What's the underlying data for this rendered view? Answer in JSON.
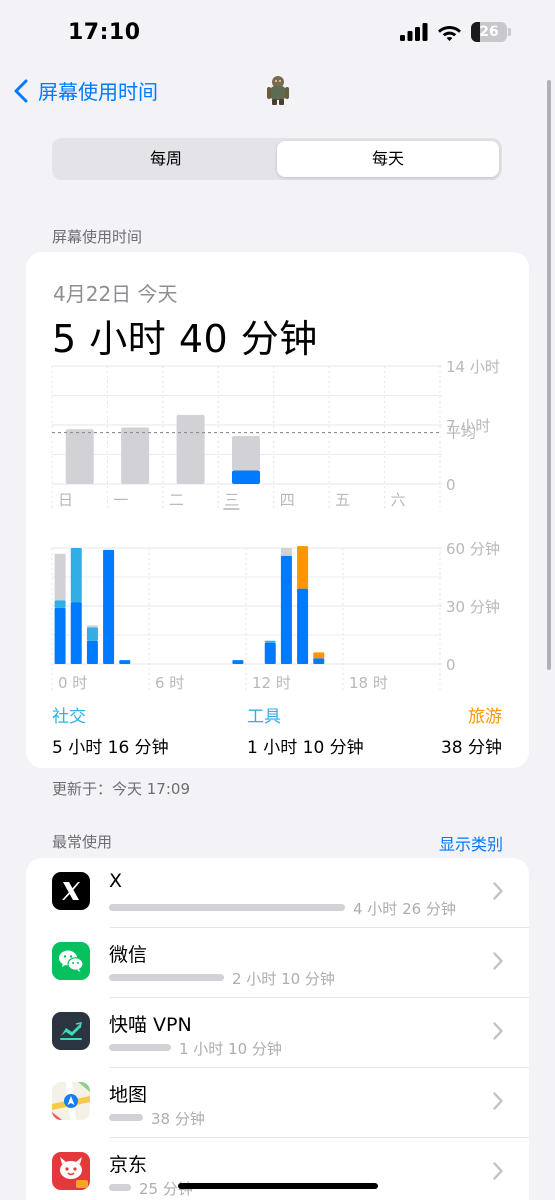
{
  "status_bar": {
    "time": "17:10",
    "battery_level": "26",
    "icons": [
      "cellular-signal-icon",
      "wifi-icon",
      "battery-icon"
    ]
  },
  "nav": {
    "back_label": "屏幕使用时间",
    "back_icon": "chevron-left-icon"
  },
  "segmented": {
    "weekly": "每周",
    "daily": "每天",
    "selected": "daily"
  },
  "section_title": "屏幕使用时间",
  "summary": {
    "date": "4月22日 今天",
    "total": "5 小时 40 分钟"
  },
  "chart_data": [
    {
      "type": "bar",
      "categories": [
        "日",
        "一",
        "二",
        "三",
        "四",
        "五",
        "六"
      ],
      "series": [
        {
          "values": [
            6.5,
            6.7,
            8.2,
            1.6,
            0,
            0,
            0
          ]
        },
        {
          "values": [
            0,
            0,
            0,
            4.1,
            0,
            0,
            0
          ]
        }
      ],
      "y_ticks": [
        "14 小时",
        "7 小时",
        "0"
      ],
      "ylim": [
        0,
        14
      ],
      "average_label": "平均",
      "average_value": 6.1,
      "today_index": 3,
      "colors": {
        "past": "#d1d1d6",
        "today": "#007aff",
        "today_other": "#d1d1d6"
      }
    },
    {
      "type": "bar",
      "x_ticks": [
        "0 时",
        "6 时",
        "12 时",
        "18 时"
      ],
      "y_ticks": [
        "60 分钟",
        "30 分钟",
        "0"
      ],
      "ylim": [
        0,
        60
      ],
      "hours": [
        0,
        1,
        2,
        3,
        4,
        11,
        13,
        14,
        15,
        16
      ],
      "series": [
        {
          "name": "社交",
          "values": [
            29,
            32,
            12,
            59,
            2,
            2,
            11,
            56,
            39,
            3
          ]
        },
        {
          "name": "工具",
          "values": [
            4,
            28,
            7,
            0,
            0,
            0,
            1,
            0,
            0,
            0
          ]
        },
        {
          "name": "旅游",
          "values": [
            0,
            0,
            0,
            0,
            0,
            0,
            0,
            0,
            22,
            3
          ]
        },
        {
          "name": "其他",
          "values": [
            24,
            0,
            1,
            0,
            0,
            0,
            0,
            4,
            0,
            0
          ]
        }
      ],
      "colors": {
        "社交": "#007aff",
        "工具": "#32ade6",
        "旅游": "#ff9500",
        "其他": "#d1d1d6"
      }
    }
  ],
  "categories": [
    {
      "name": "社交",
      "time": "5 小时 16 分钟",
      "color": "#32ade6"
    },
    {
      "name": "工具",
      "time": "1 小时 10 分钟",
      "color": "#32ade6"
    },
    {
      "name": "旅游",
      "time": "38 分钟",
      "color": "#ff9500"
    }
  ],
  "updated": "更新于：今天 17:09",
  "most_used": {
    "title": "最常使用",
    "show_categories": "显示类别",
    "apps": [
      {
        "name": "X",
        "time": "4 小时 26 分钟",
        "minutes": 266,
        "icon": "x-app-icon"
      },
      {
        "name": "微信",
        "time": "2 小时 10 分钟",
        "minutes": 130,
        "icon": "wechat-app-icon"
      },
      {
        "name": "快喵 VPN",
        "time": "1 小时 10 分钟",
        "minutes": 70,
        "icon": "vpn-app-icon"
      },
      {
        "name": "地图",
        "time": "38 分钟",
        "minutes": 38,
        "icon": "maps-app-icon"
      },
      {
        "name": "京东",
        "time": "25 分钟",
        "minutes": 25,
        "icon": "jd-app-icon"
      }
    ]
  }
}
